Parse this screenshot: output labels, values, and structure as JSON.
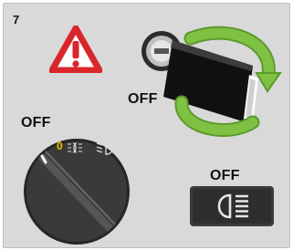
{
  "step": {
    "number": "7"
  },
  "labels": {
    "key": "OFF",
    "knob": "OFF",
    "button": "OFF"
  },
  "knob": {
    "positions": [
      "0",
      "parking-light",
      "low-beam"
    ],
    "zero_label": "0",
    "selected_position": "0"
  },
  "icons": {
    "warning": "warning-triangle-icon",
    "key": "vehicle-key-icon",
    "rotate": "rotate-arrow-icon",
    "knob": "light-switch-knob",
    "parking": "parking-light-icon",
    "lowbeam": "low-beam-icon",
    "button": "headlight-button-icon"
  },
  "colors": {
    "panel": "#d9d9d9",
    "warning_red": "#d9262b",
    "arrow_green": "#7fc243",
    "knob_dark": "#3a3a3a",
    "zero_yellow": "#f2c600"
  }
}
